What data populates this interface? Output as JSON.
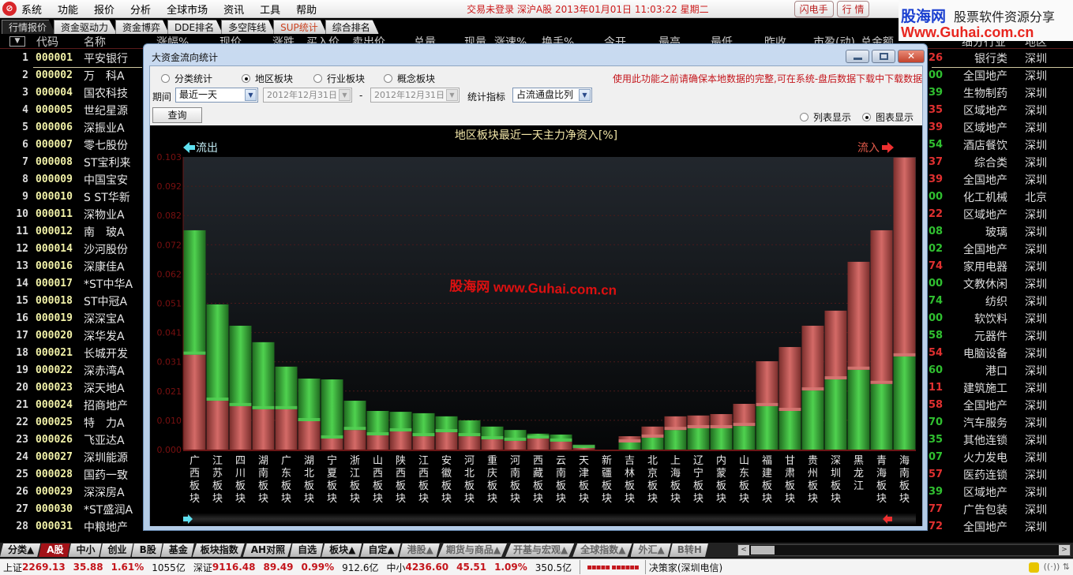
{
  "menubar": {
    "items": [
      "系统",
      "功能",
      "报价",
      "分析",
      "全球市场",
      "资讯",
      "工具",
      "帮助"
    ],
    "status": "交易未登录  深沪A股  2013年01月01日  11:03:22  星期二",
    "buttons": [
      "闪电手",
      "行 情"
    ]
  },
  "brand": {
    "name": "股海网",
    "slogan": "股票软件资源分享",
    "url": "Www.Guhai.com.cn"
  },
  "tabs": [
    {
      "label": "行情报价",
      "active": true
    },
    {
      "label": "资金驱动力"
    },
    {
      "label": "资金博弈"
    },
    {
      "label": "DDE排名"
    },
    {
      "label": "多空阵线"
    },
    {
      "label": "SUP统计",
      "highlight": true
    },
    {
      "label": "综合排名"
    }
  ],
  "table": {
    "sort_icon": "▼",
    "headers": [
      "代码",
      "名称",
      "涨幅%",
      "现价",
      "涨跌",
      "买入价",
      "卖出价",
      "总量",
      "现量",
      "涨速%",
      "换手%",
      "今开",
      "最高",
      "最低",
      "昨收",
      "市盈(动)",
      "总金额",
      "细分行业",
      "地区"
    ],
    "rows": [
      {
        "idx": "1",
        "code": "000001",
        "name": "平安银行",
        "frag": "26",
        "fc": "#e03030",
        "industry": "银行类",
        "region": "深圳"
      },
      {
        "idx": "2",
        "code": "000002",
        "name": "万　科A",
        "frag": "00",
        "fc": "#30c030",
        "industry": "全国地产",
        "region": "深圳"
      },
      {
        "idx": "3",
        "code": "000004",
        "name": "国农科技",
        "frag": "39",
        "fc": "#30c030",
        "industry": "生物制药",
        "region": "深圳"
      },
      {
        "idx": "4",
        "code": "000005",
        "name": "世纪星源",
        "frag": "35",
        "fc": "#e03030",
        "industry": "区域地产",
        "region": "深圳"
      },
      {
        "idx": "5",
        "code": "000006",
        "name": "深振业A",
        "frag": "39",
        "fc": "#e03030",
        "industry": "区域地产",
        "region": "深圳"
      },
      {
        "idx": "6",
        "code": "000007",
        "name": "零七股份",
        "frag": "54",
        "fc": "#30c030",
        "industry": "酒店餐饮",
        "region": "深圳"
      },
      {
        "idx": "7",
        "code": "000008",
        "name": "ST宝利来",
        "frag": "37",
        "fc": "#e03030",
        "industry": "综合类",
        "region": "深圳"
      },
      {
        "idx": "8",
        "code": "000009",
        "name": "中国宝安",
        "frag": "39",
        "fc": "#e03030",
        "industry": "全国地产",
        "region": "深圳"
      },
      {
        "idx": "9",
        "code": "000010",
        "name": "S ST华新",
        "frag": "00",
        "fc": "#30c030",
        "industry": "化工机械",
        "region": "北京"
      },
      {
        "idx": "10",
        "code": "000011",
        "name": "深物业A",
        "frag": "22",
        "fc": "#e03030",
        "industry": "区域地产",
        "region": "深圳"
      },
      {
        "idx": "11",
        "code": "000012",
        "name": "南　玻A",
        "frag": "08",
        "fc": "#30c030",
        "industry": "玻璃",
        "region": "深圳"
      },
      {
        "idx": "12",
        "code": "000014",
        "name": "沙河股份",
        "frag": "02",
        "fc": "#30c030",
        "industry": "全国地产",
        "region": "深圳"
      },
      {
        "idx": "13",
        "code": "000016",
        "name": "深康佳A",
        "frag": "74",
        "fc": "#e03030",
        "industry": "家用电器",
        "region": "深圳"
      },
      {
        "idx": "14",
        "code": "000017",
        "name": "*ST中华A",
        "frag": "00",
        "fc": "#30c030",
        "industry": "文教休闲",
        "region": "深圳"
      },
      {
        "idx": "15",
        "code": "000018",
        "name": "ST中冠A",
        "frag": "74",
        "fc": "#30c030",
        "industry": "纺织",
        "region": "深圳"
      },
      {
        "idx": "16",
        "code": "000019",
        "name": "深深宝A",
        "frag": "00",
        "fc": "#30c030",
        "industry": "软饮料",
        "region": "深圳"
      },
      {
        "idx": "17",
        "code": "000020",
        "name": "深华发A",
        "frag": "58",
        "fc": "#30c030",
        "industry": "元器件",
        "region": "深圳"
      },
      {
        "idx": "18",
        "code": "000021",
        "name": "长城开发",
        "frag": "54",
        "fc": "#e03030",
        "industry": "电脑设备",
        "region": "深圳"
      },
      {
        "idx": "19",
        "code": "000022",
        "name": "深赤湾A",
        "frag": "60",
        "fc": "#30c030",
        "industry": "港口",
        "region": "深圳"
      },
      {
        "idx": "20",
        "code": "000023",
        "name": "深天地A",
        "frag": "11",
        "fc": "#e03030",
        "industry": "建筑施工",
        "region": "深圳"
      },
      {
        "idx": "21",
        "code": "000024",
        "name": "招商地产",
        "frag": "58",
        "fc": "#e03030",
        "industry": "全国地产",
        "region": "深圳"
      },
      {
        "idx": "22",
        "code": "000025",
        "name": "特　力A",
        "frag": "70",
        "fc": "#30c030",
        "industry": "汽车服务",
        "region": "深圳"
      },
      {
        "idx": "23",
        "code": "000026",
        "name": "飞亚达A",
        "frag": "35",
        "fc": "#30c030",
        "industry": "其他连锁",
        "region": "深圳"
      },
      {
        "idx": "24",
        "code": "000027",
        "name": "深圳能源",
        "frag": "07",
        "fc": "#30c030",
        "industry": "火力发电",
        "region": "深圳"
      },
      {
        "idx": "25",
        "code": "000028",
        "name": "国药一致",
        "frag": "57",
        "fc": "#e03030",
        "industry": "医药连锁",
        "region": "深圳"
      },
      {
        "idx": "26",
        "code": "000029",
        "name": "深深房A",
        "frag": "39",
        "fc": "#30c030",
        "industry": "区域地产",
        "region": "深圳"
      },
      {
        "idx": "27",
        "code": "000030",
        "name": "*ST盛润A",
        "frag": "77",
        "fc": "#e03030",
        "industry": "广告包装",
        "region": "深圳"
      },
      {
        "idx": "28",
        "code": "000031",
        "name": "中粮地产",
        "frag": "72",
        "fc": "#e03030",
        "industry": "全国地产",
        "region": "深圳"
      }
    ]
  },
  "dialog": {
    "title": "大资金流向统计",
    "radios": [
      {
        "label": "分类统计",
        "checked": false
      },
      {
        "label": "地区板块",
        "checked": true
      },
      {
        "label": "行业板块",
        "checked": false
      },
      {
        "label": "概念板块",
        "checked": false
      }
    ],
    "warning": "使用此功能之前请确保本地数据的完整,可在系统-盘后数据下载中下载数据",
    "period_label": "期间",
    "period_value": "最近一天",
    "date_from": "2012年12月31日",
    "date_sep": "-",
    "date_to": "2012年12月31日",
    "metric_label": "统计指标",
    "metric_value": "占流通盘比列",
    "query_button": "查询",
    "view_radios": [
      {
        "label": "列表显示",
        "checked": false
      },
      {
        "label": "图表显示",
        "checked": true
      }
    ]
  },
  "chart_data": {
    "type": "bar",
    "title": "地区板块最近一天主力净资入[%]",
    "left_label": "流出",
    "right_label": "流入",
    "watermark": "股海网  www.Guhai.com.cn",
    "ylim": [
      0,
      0.103
    ],
    "yticks": [
      "0.000",
      "0.010",
      "0.021",
      "0.031",
      "0.041",
      "0.051",
      "0.062",
      "0.072",
      "0.082",
      "0.092",
      "0.103"
    ],
    "grid": true,
    "categories": [
      "广西板块",
      "江苏板块",
      "四川板块",
      "湖南板块",
      "广东板块",
      "湖北板块",
      "宁夏板块",
      "浙江板块",
      "山西板块",
      "陕西板块",
      "江西板块",
      "安徽板块",
      "河北板块",
      "重庆板块",
      "河南板块",
      "西藏板块",
      "云南板块",
      "天津板块",
      "新疆板块",
      "吉林板块",
      "北京板块",
      "上海板块",
      "辽宁板块",
      "内蒙板块",
      "山东板块",
      "福建板块",
      "甘肃板块",
      "贵州板块",
      "深圳板块",
      "黑龙江",
      "青海板块",
      "海南板块"
    ],
    "series": [
      {
        "name": "流出 (red)",
        "values": [
          0.0334,
          0.0172,
          0.0153,
          0.0142,
          0.0142,
          0.01,
          0.0039,
          0.0069,
          0.005,
          0.0064,
          0.0047,
          0.0061,
          0.0047,
          0.0036,
          0.0031,
          0.0039,
          0.0028,
          0.0006,
          0.0,
          0.0022,
          0.0039,
          0.0048,
          0.0045,
          0.005,
          0.0078,
          0.0158,
          0.0225,
          0.0228,
          0.0242,
          0.038,
          0.0541,
          0.07
        ]
      },
      {
        "name": "流入 (green)",
        "values": [
          0.0438,
          0.0339,
          0.0283,
          0.0236,
          0.015,
          0.015,
          0.0208,
          0.0103,
          0.0086,
          0.0069,
          0.0081,
          0.0056,
          0.0056,
          0.0045,
          0.0038,
          0.0017,
          0.0025,
          0.0005,
          0.0,
          0.0025,
          0.0042,
          0.0069,
          0.0075,
          0.0075,
          0.0083,
          0.0153,
          0.0136,
          0.0208,
          0.0247,
          0.0281,
          0.0231,
          0.0328
        ]
      }
    ],
    "outflow_side_count": 18,
    "colors": {
      "outflow": "#c05a58",
      "inflow": "#3fb83f",
      "axis_label": "#7a1010",
      "title": "#f2e6a8"
    }
  },
  "bottom_tabs": [
    {
      "label": "分类▲"
    },
    {
      "label": "A股",
      "active": true
    },
    {
      "label": "中小"
    },
    {
      "label": "创业"
    },
    {
      "label": "B股"
    },
    {
      "label": "基金"
    },
    {
      "label": "板块指数"
    },
    {
      "label": "AH对照"
    },
    {
      "label": "自选"
    },
    {
      "label": "板块▲"
    },
    {
      "label": "自定▲"
    },
    {
      "label": "港股▲",
      "dim": true
    },
    {
      "label": "期货与商品▲",
      "dim": true
    },
    {
      "label": "开基与宏观▲",
      "dim": true
    },
    {
      "label": "全球指数▲",
      "dim": true
    },
    {
      "label": "外汇▲",
      "dim": true
    },
    {
      "label": "B转H",
      "dim": true
    }
  ],
  "statusbar": {
    "sh_label": "上证",
    "sh_value": "2269.13",
    "sh_change": "35.88",
    "sh_pct": "1.61%",
    "sh_amount": "1055亿",
    "sz_label": "深证",
    "sz_value": "9116.48",
    "sz_change": "89.49",
    "sz_pct": "0.99%",
    "sz_amount": "912.6亿",
    "zx_label": "中小",
    "zx_value": "4236.60",
    "zx_change": "45.51",
    "zx_pct": "1.09%",
    "zx_amount": "350.5亿",
    "server": "决策家(深圳电信)"
  }
}
